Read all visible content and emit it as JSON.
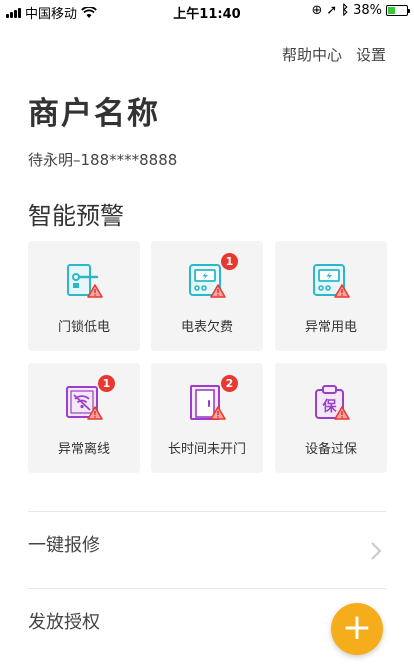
{
  "status_bar": {
    "carrier": "中国移动",
    "time": "上午11:40",
    "battery": "38%",
    "battery_level": 0.38
  },
  "header": {
    "help_label": "帮助中心",
    "settings_label": "设置"
  },
  "merchant": {
    "name": "商户名称",
    "contact": "待永明–188****8888"
  },
  "alerts": {
    "title": "智能预警",
    "items": [
      {
        "label": "门锁低电",
        "icon": "door-lock-low-battery-icon",
        "badge": ""
      },
      {
        "label": "电表欠费",
        "icon": "meter-arrears-icon",
        "badge": "1"
      },
      {
        "label": "异常用电",
        "icon": "abnormal-power-icon",
        "badge": ""
      },
      {
        "label": "异常离线",
        "icon": "offline-icon",
        "badge": "1"
      },
      {
        "label": "长时间未开门",
        "icon": "door-not-opened-icon",
        "badge": "2"
      },
      {
        "label": "设备过保",
        "icon": "warranty-expired-icon",
        "badge": ""
      }
    ]
  },
  "menu": {
    "repair_label": "一键报修",
    "authorize_label": "发放授权"
  },
  "fab": {
    "symbol": "+"
  },
  "colors": {
    "teal": "#2ab8c8",
    "purple": "#9b3fc8",
    "warning_red": "#e8382f",
    "fab": "#f5ad1c",
    "tile_bg": "#f4f4f4"
  }
}
